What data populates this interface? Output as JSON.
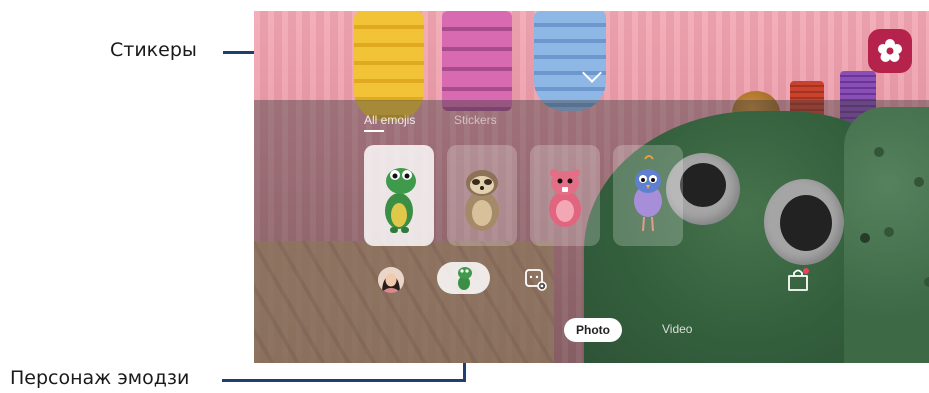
{
  "callouts": {
    "stickers": "Стикеры",
    "emoji_character": "Персонаж эмодзи"
  },
  "tabs": [
    {
      "label": "All emojis",
      "active": true
    },
    {
      "label": "Stickers",
      "active": false
    }
  ],
  "stickers": [
    {
      "name": "dino",
      "selected": true
    },
    {
      "name": "sloth",
      "selected": false
    },
    {
      "name": "pink-hamster",
      "selected": false
    },
    {
      "name": "purple-bird",
      "selected": false
    }
  ],
  "modes": {
    "photo": "Photo",
    "video": "Video",
    "active": "Photo"
  },
  "colors": {
    "effect_button": "#b5234d",
    "callout_line": "#1f3f6e"
  },
  "icons": {
    "effects": "flower-icon",
    "collapse": "chevron-down-icon",
    "sticker_settings": "sticker-settings-icon",
    "store": "shopping-bag-icon"
  }
}
